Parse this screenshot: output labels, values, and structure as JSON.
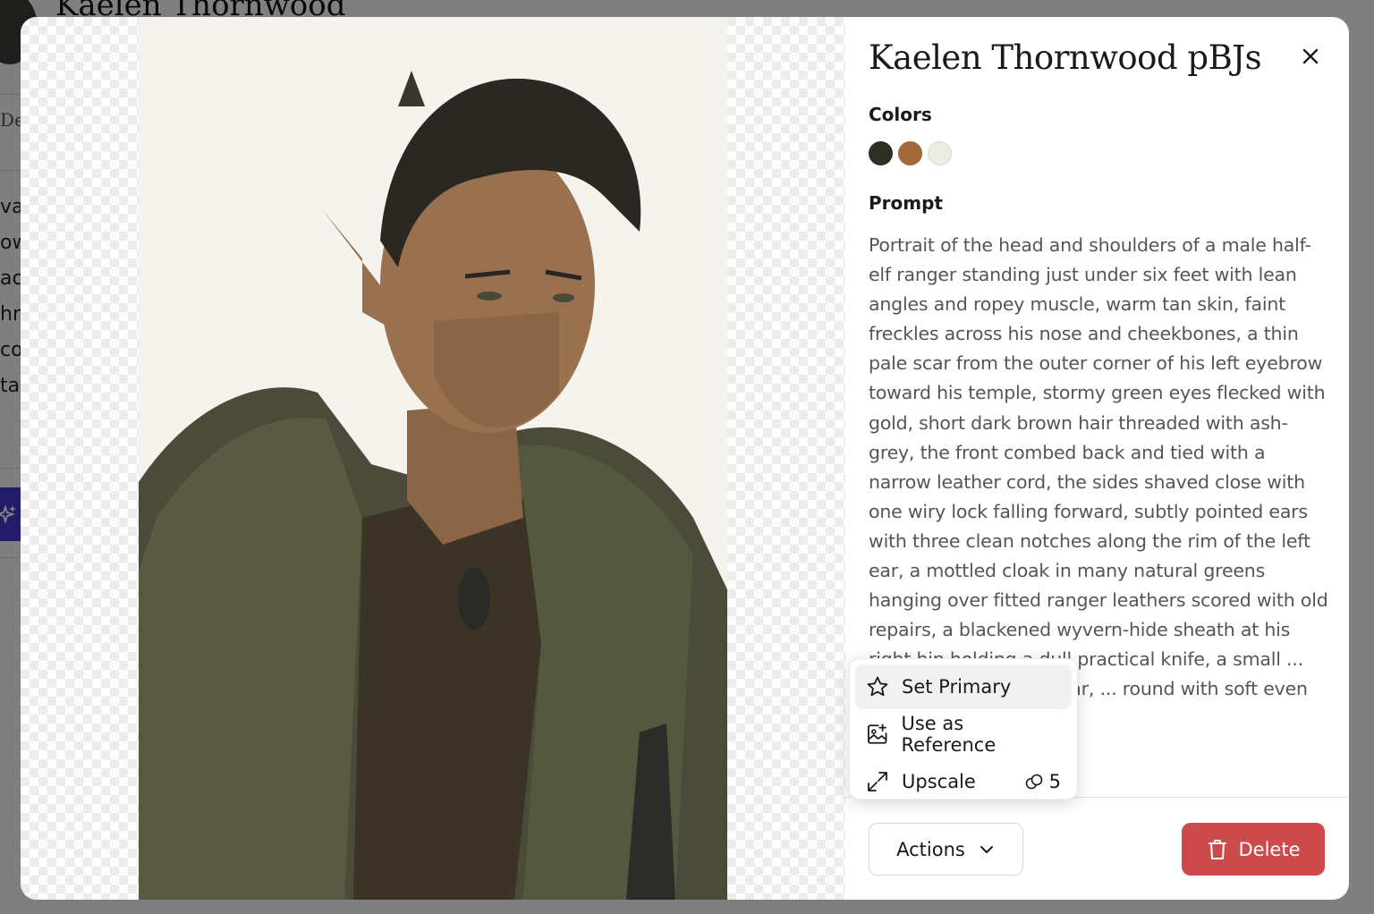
{
  "background": {
    "title": "Kaelen Thornwood",
    "subtitle": "De",
    "lines": [
      "va",
      "ow",
      "ac",
      "hr",
      "co",
      "ta"
    ]
  },
  "modal": {
    "title": "Kaelen Thornwood pBJs",
    "colors_label": "Colors",
    "colors": [
      "#2f2f24",
      "#a26a3c",
      "#ecebe4"
    ],
    "prompt_label": "Prompt",
    "prompt": "Portrait of the head and shoulders of a male half-elf ranger standing just under six feet with lean angles and ropey muscle, warm tan skin, faint freckles across his nose and cheekbones, a thin pale scar from the outer corner of his left eyebrow toward his temple, stormy green eyes flecked with gold, short dark brown hair threaded with ash-grey, the front combed back and tied with a narrow leather cord, the sides shaved close with one wiry lock falling forward, subtly pointed ears with three clean notches along the rim of the left ear, a mottled cloak in many natural greens hanging over fitted ranger leathers scored with old repairs, a blackened wyvern-hide sheath at his right hip holding a dull practical knife, a small ... nearly black at his collar, ... round with soft even",
    "actions_label": "Actions",
    "delete_label": "Delete"
  },
  "menu": {
    "items": [
      {
        "label": "Set Primary",
        "icon": "star-icon"
      },
      {
        "label": "Use as Reference",
        "icon": "image-plus-icon"
      },
      {
        "label": "Upscale",
        "icon": "expand-icon",
        "credits": "5"
      }
    ]
  },
  "icons": {
    "close": "close-icon",
    "chevron": "chevron-down-icon",
    "trash": "trash-icon",
    "coins": "coins-icon"
  },
  "theme": {
    "accent_delete": "#cc4a4a",
    "bg_button": "#4338ca"
  }
}
